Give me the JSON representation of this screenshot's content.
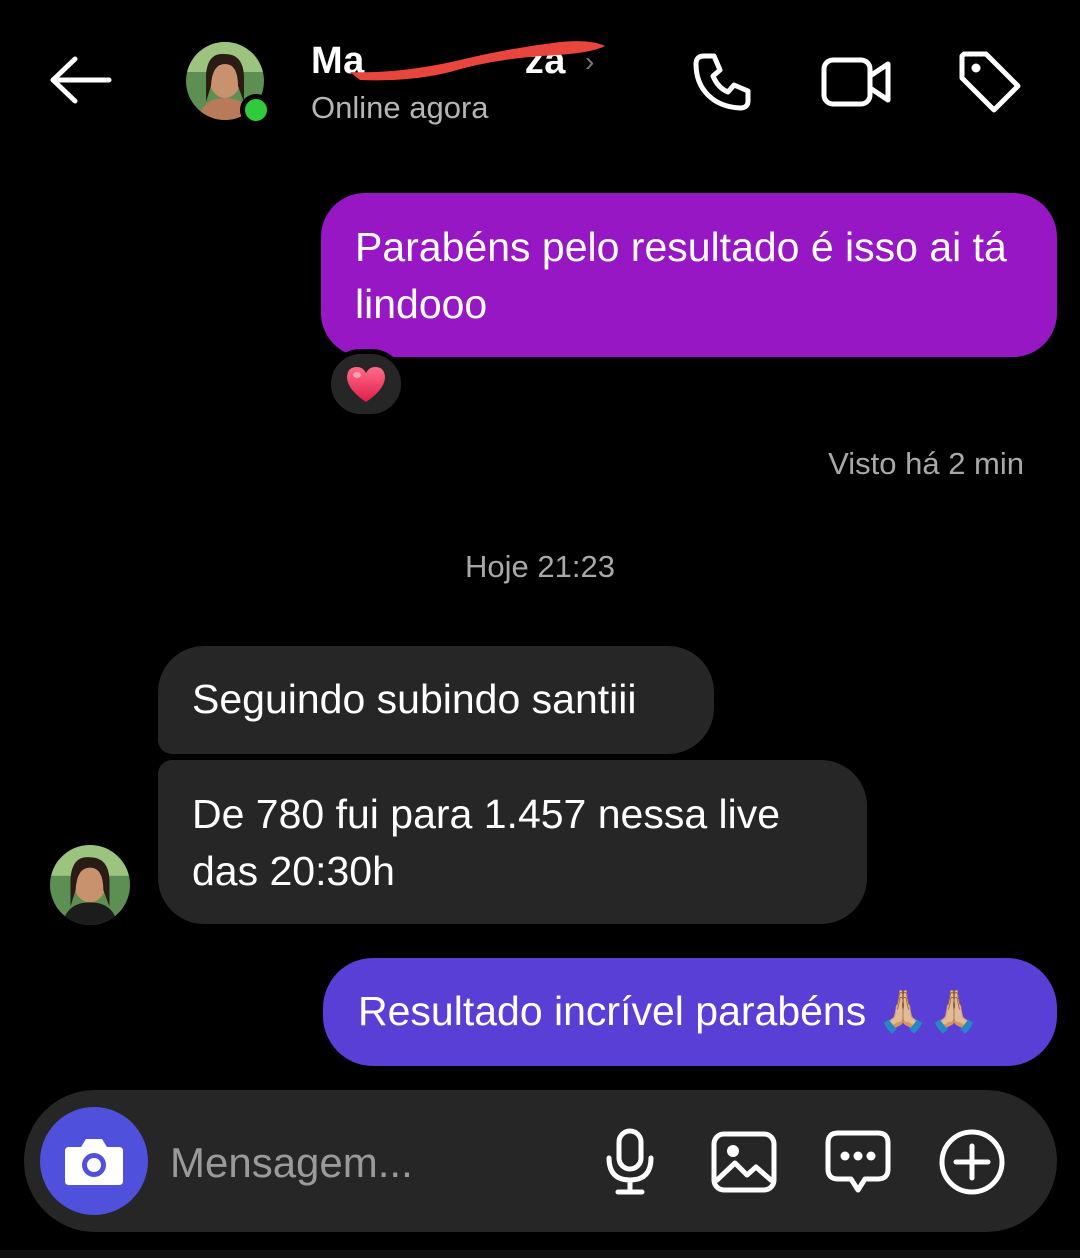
{
  "header": {
    "contact_name": "Ma",
    "contact_name_tail": "za",
    "status": "Online agora",
    "icons": [
      "back-arrow-icon",
      "phone-icon",
      "video-camera-icon",
      "tag-icon"
    ]
  },
  "messages": {
    "sent_1": "Parabéns pelo resultado é isso ai tá lindooo",
    "reaction": "❤️",
    "seen": "Visto há 2 min",
    "timestamp": "Hoje 21:23",
    "received_1": "Seguindo subindo santiii",
    "received_2": "De 780 fui para 1.457 nessa live das 20:30h",
    "sent_2": "Resultado incrível parabéns 🙏🏼🙏🏼"
  },
  "composer": {
    "placeholder": "Mensagem...",
    "icons": [
      "camera-icon",
      "microphone-icon",
      "gallery-icon",
      "sticker-chat-icon",
      "add-circle-icon"
    ]
  },
  "colors": {
    "background": "#000000",
    "sent_bubble_1": "#9817c5",
    "sent_bubble_2": "#5a3fd6",
    "received_bubble": "#262626",
    "online": "#2fcb3a",
    "camera_button": "#4f50dc"
  }
}
